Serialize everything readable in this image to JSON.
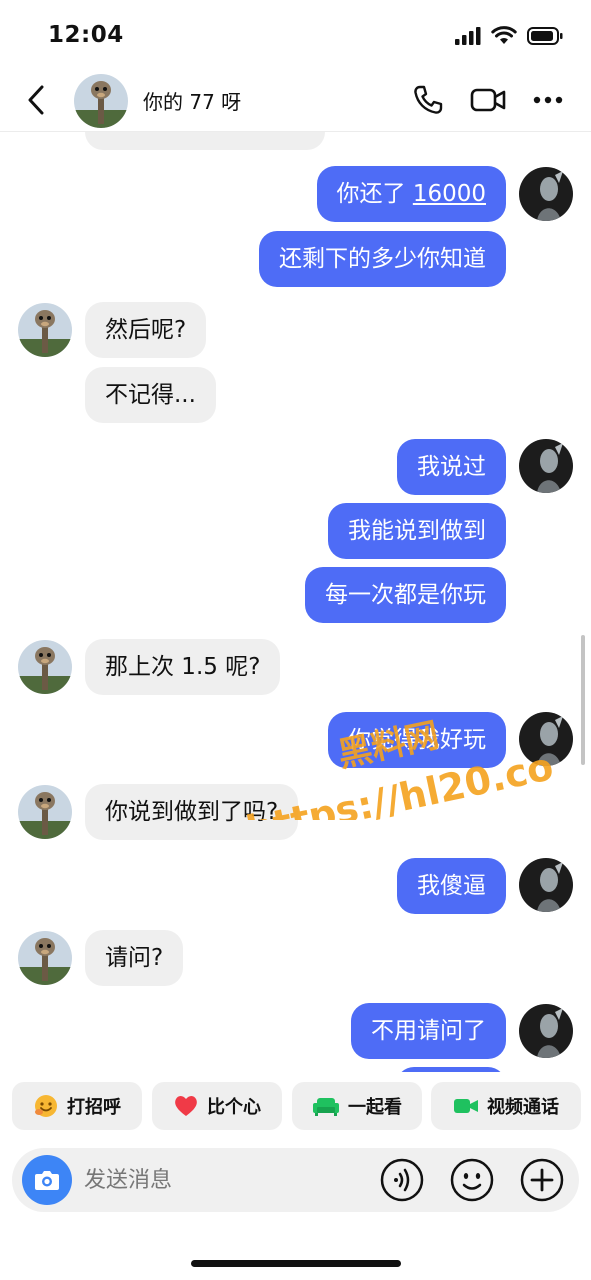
{
  "status_bar": {
    "time": "12:04"
  },
  "header": {
    "contact_name": "你的 77 呀"
  },
  "messages": [
    {
      "dir": "out",
      "text_before": "你还了 ",
      "text_link": "16000"
    },
    {
      "dir": "out",
      "text": "还剩下的多少你知道"
    },
    {
      "dir": "in",
      "text": "然后呢?"
    },
    {
      "dir": "in",
      "text": "不记得..."
    },
    {
      "dir": "out",
      "text": "我说过"
    },
    {
      "dir": "out",
      "text": "我能说到做到"
    },
    {
      "dir": "out",
      "text": "每一次都是你玩"
    },
    {
      "dir": "in",
      "text": "那上次 1.5 呢?"
    },
    {
      "dir": "out",
      "text": "你觉得我好玩"
    },
    {
      "dir": "in",
      "text": "你说到做到了吗?"
    },
    {
      "dir": "out",
      "text": "我傻逼"
    },
    {
      "dir": "in",
      "text": "请问?"
    },
    {
      "dir": "out",
      "text": "不用请问了"
    }
  ],
  "watermark": {
    "line1": "黑料网",
    "line2": "https://hl20.co"
  },
  "quick_actions": [
    {
      "label": "打招呼",
      "icon": "smile-wave-icon",
      "color": "#f5a623"
    },
    {
      "label": "比个心",
      "icon": "heart-icon",
      "color": "#f03a47"
    },
    {
      "label": "一起看",
      "icon": "sofa-icon",
      "color": "#1fc15f"
    },
    {
      "label": "视频通话",
      "icon": "video-camera-icon",
      "color": "#1fc15f"
    }
  ],
  "composer": {
    "placeholder": "发送消息"
  },
  "colors": {
    "outgoing_bubble": "#4e6cf6",
    "incoming_bubble": "#efefef",
    "camera_button": "#3d85f6",
    "watermark": "#f5a21f"
  }
}
